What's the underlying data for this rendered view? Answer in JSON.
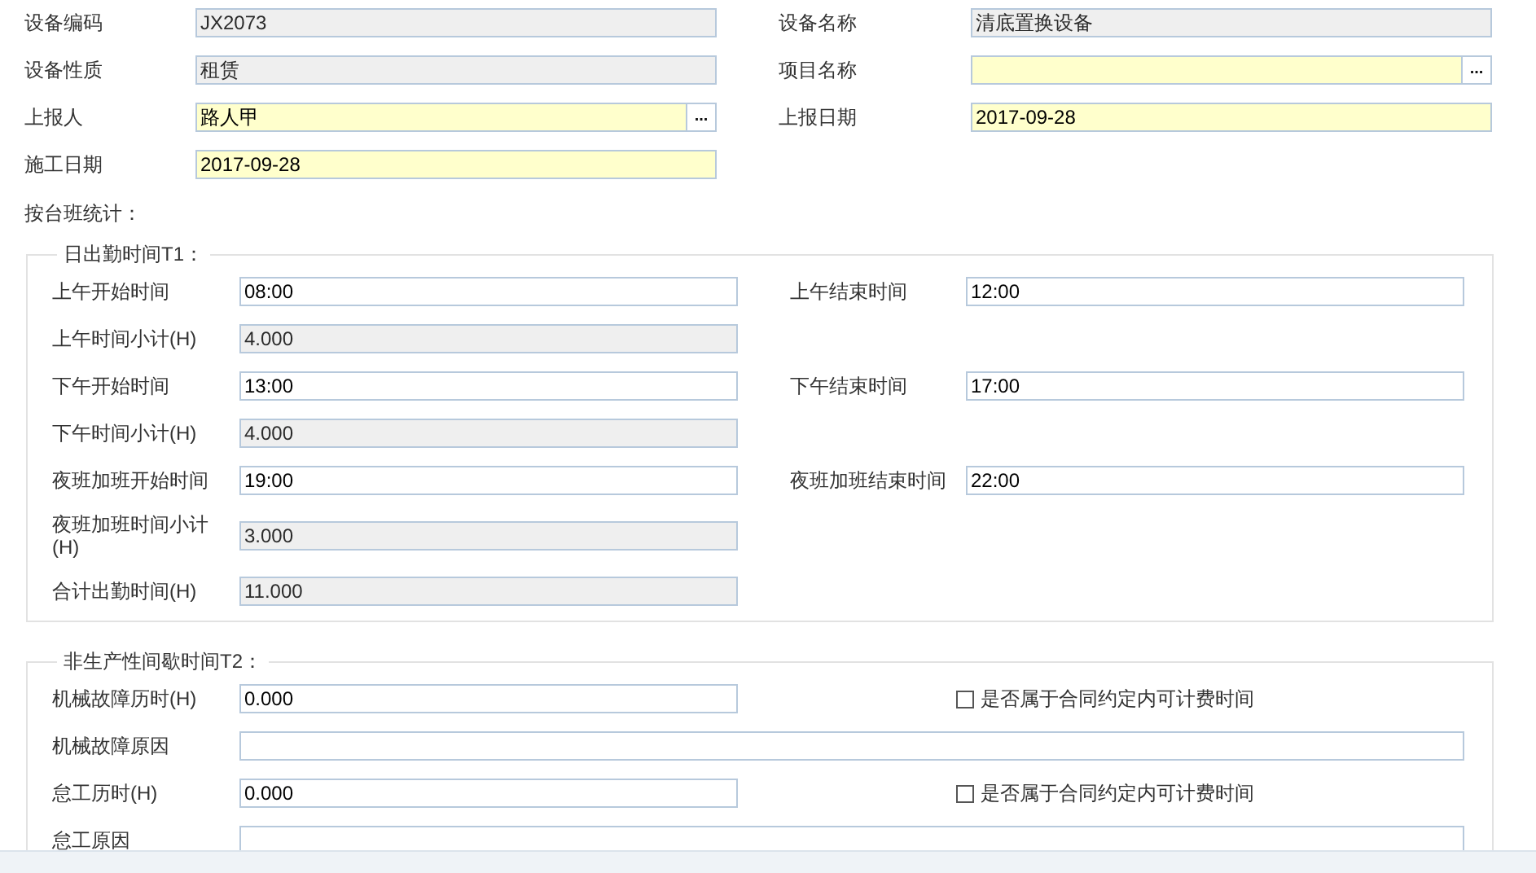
{
  "header": {
    "rows": [
      [
        {
          "kind": "field",
          "label": "设备编码",
          "value": "JX2073",
          "readonly": true,
          "required": false
        },
        {
          "kind": "field",
          "label": "设备名称",
          "value": "清底置换设备",
          "readonly": true,
          "required": false
        }
      ],
      [
        {
          "kind": "field",
          "label": "设备性质",
          "value": "租赁",
          "readonly": true,
          "required": false
        },
        {
          "kind": "field",
          "label": "项目名称",
          "readonly": false,
          "required": true,
          "button": "..."
        }
      ],
      [
        {
          "kind": "field",
          "label": "上报人",
          "value": "路人甲",
          "readonly": false,
          "required": true,
          "button": "..."
        },
        {
          "kind": "field",
          "label": "上报日期",
          "value": "2017-09-28",
          "readonly": false,
          "required": true
        }
      ],
      [
        {
          "kind": "field",
          "label": "施工日期",
          "value": "2017-09-28",
          "readonly": false,
          "required": true
        }
      ]
    ]
  },
  "stats_label": "按台班统计：",
  "sections": [
    {
      "legend": "日出勤时间T1：",
      "rows": [
        [
          {
            "kind": "field",
            "label": "上午开始时间",
            "value": "08:00",
            "readonly": false,
            "required": false
          },
          {
            "kind": "field",
            "label": "上午结束时间",
            "value": "12:00",
            "readonly": false,
            "required": false
          }
        ],
        [
          {
            "kind": "field",
            "label": "上午时间小计(H)",
            "value": "4.000",
            "readonly": true,
            "required": false
          }
        ],
        [
          {
            "kind": "field",
            "label": "下午开始时间",
            "value": "13:00",
            "readonly": false,
            "required": false
          },
          {
            "kind": "field",
            "label": "下午结束时间",
            "value": "17:00",
            "readonly": false,
            "required": false
          }
        ],
        [
          {
            "kind": "field",
            "label": "下午时间小计(H)",
            "value": "4.000",
            "readonly": true,
            "required": false
          }
        ],
        [
          {
            "kind": "field",
            "label": "夜班加班开始时间",
            "value": "19:00",
            "readonly": false,
            "required": false
          },
          {
            "kind": "field",
            "label": "夜班加班结束时间",
            "value": "22:00",
            "readonly": false,
            "required": false
          }
        ],
        [
          {
            "kind": "field",
            "label": "夜班加班时间小计(H)",
            "value": "3.000",
            "readonly": true,
            "required": false
          }
        ],
        [
          {
            "kind": "field",
            "label": "合计出勤时间(H)",
            "value": "11.000",
            "readonly": true,
            "required": false
          }
        ]
      ]
    },
    {
      "legend": "非生产性间歇时间T2：",
      "rows": [
        [
          {
            "kind": "field",
            "label": "机械故障历时(H)",
            "value": "0.000",
            "readonly": false,
            "required": false
          },
          {
            "kind": "checkbox",
            "label": "是否属于合同约定内可计费时间",
            "checked": false
          }
        ],
        [
          {
            "kind": "wide",
            "label": "机械故障原因",
            "readonly": false,
            "required": false
          }
        ],
        [
          {
            "kind": "field",
            "label": "怠工历时(H)",
            "value": "0.000",
            "readonly": false,
            "required": false
          },
          {
            "kind": "checkbox",
            "label": "是否属于合同约定内可计费时间",
            "checked": false
          }
        ],
        [
          {
            "kind": "wide",
            "label": "怠工原因",
            "readonly": false,
            "required": false
          }
        ]
      ]
    }
  ]
}
